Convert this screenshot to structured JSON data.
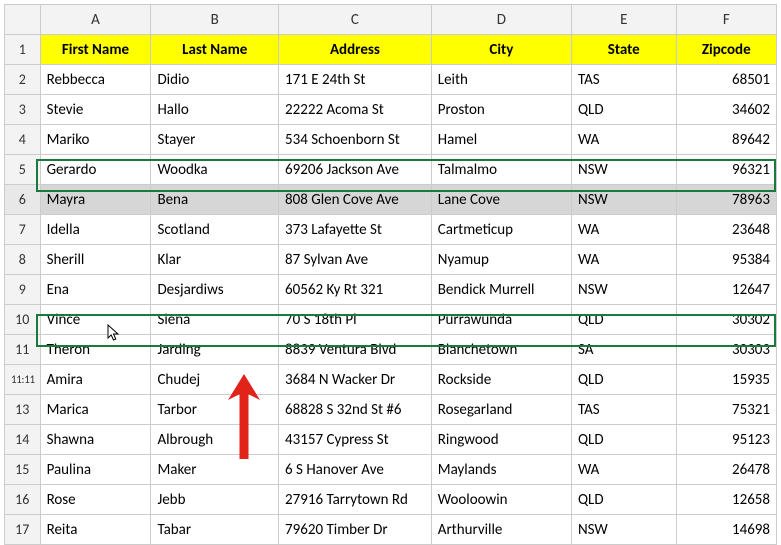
{
  "columns": [
    "A",
    "B",
    "C",
    "D",
    "E",
    "F"
  ],
  "headers": {
    "firstName": "First Name",
    "lastName": "Last Name",
    "address": "Address",
    "city": "City",
    "state": "State",
    "zipcode": "Zipcode"
  },
  "rowNumbers": [
    "1",
    "2",
    "3",
    "4",
    "5",
    "6",
    "7",
    "8",
    "9",
    "10",
    "11",
    "11:11",
    "13",
    "14",
    "15",
    "16",
    "17"
  ],
  "rows": [
    {
      "firstName": "Rebbecca",
      "lastName": "Didio",
      "address": "171 E 24th St",
      "city": "Leith",
      "state": "TAS",
      "zipcode": "68501"
    },
    {
      "firstName": "Stevie",
      "lastName": "Hallo",
      "address": "22222 Acoma St",
      "city": "Proston",
      "state": "QLD",
      "zipcode": "34602"
    },
    {
      "firstName": "Mariko",
      "lastName": "Stayer",
      "address": "534 Schoenborn St",
      "city": "Hamel",
      "state": "WA",
      "zipcode": "89642"
    },
    {
      "firstName": "Gerardo",
      "lastName": "Woodka",
      "address": "69206 Jackson Ave",
      "city": "Talmalmo",
      "state": "NSW",
      "zipcode": "96321"
    },
    {
      "firstName": "Mayra",
      "lastName": "Bena",
      "address": "808 Glen Cove Ave",
      "city": "Lane Cove",
      "state": "NSW",
      "zipcode": "78963"
    },
    {
      "firstName": "Idella",
      "lastName": "Scotland",
      "address": "373 Lafayette St",
      "city": "Cartmeticup",
      "state": "WA",
      "zipcode": "23648"
    },
    {
      "firstName": "Sherill",
      "lastName": "Klar",
      "address": "87 Sylvan Ave",
      "city": "Nyamup",
      "state": "WA",
      "zipcode": "95384"
    },
    {
      "firstName": "Ena",
      "lastName": "Desjardiws",
      "address": "60562 Ky Rt 321",
      "city": "Bendick Murrell",
      "state": "NSW",
      "zipcode": "12647"
    },
    {
      "firstName": "Vince",
      "lastName": "Siena",
      "address": "70 S 18th Pl",
      "city": "Purrawunda",
      "state": "QLD",
      "zipcode": "30302"
    },
    {
      "firstName": "Theron",
      "lastName": "Jarding",
      "address": "8839 Ventura Blvd",
      "city": "Blanchetown",
      "state": "SA",
      "zipcode": "30303"
    },
    {
      "firstName": "Amira",
      "lastName": "Chudej",
      "address": "3684 N Wacker Dr",
      "city": "Rockside",
      "state": "QLD",
      "zipcode": "15935"
    },
    {
      "firstName": "Marica",
      "lastName": "Tarbor",
      "address": "68828 S 32nd St #6",
      "city": "Rosegarland",
      "state": "TAS",
      "zipcode": "75321"
    },
    {
      "firstName": "Shawna",
      "lastName": "Albrough",
      "address": "43157 Cypress St",
      "city": "Ringwood",
      "state": "QLD",
      "zipcode": "95123"
    },
    {
      "firstName": "Paulina",
      "lastName": "Maker",
      "address": "6 S Hanover Ave",
      "city": "Maylands",
      "state": "WA",
      "zipcode": "26478"
    },
    {
      "firstName": "Rose",
      "lastName": "Jebb",
      "address": "27916 Tarrytown Rd",
      "city": "Wooloowin",
      "state": "QLD",
      "zipcode": "12658"
    },
    {
      "firstName": "Reita",
      "lastName": "Tabar",
      "address": "79620 Timber Dr",
      "city": "Arthurville",
      "state": "NSW",
      "zipcode": "14698"
    }
  ],
  "selectedRowIndex": 4,
  "selectedRowIndex2": 9
}
